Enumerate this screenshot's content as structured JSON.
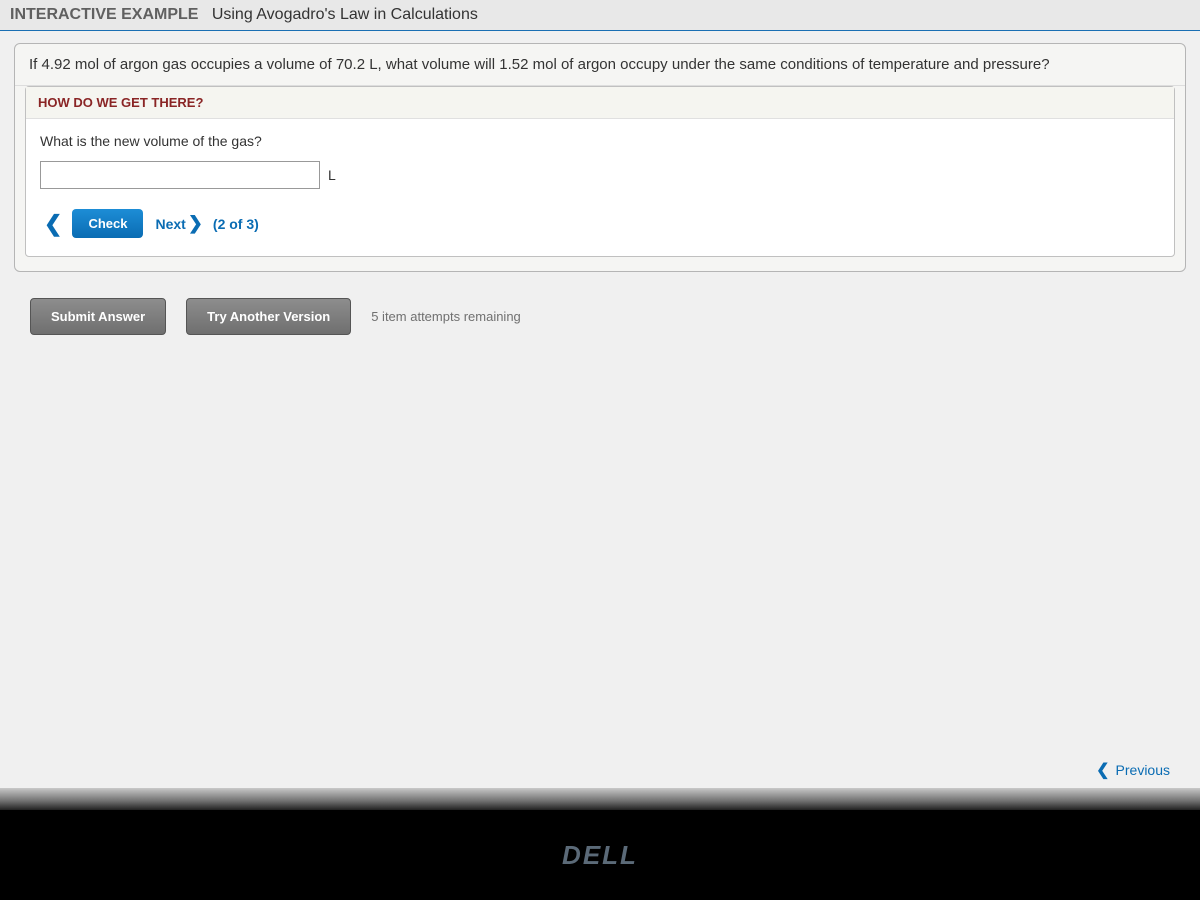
{
  "header": {
    "label": "INTERACTIVE EXAMPLE",
    "title": "Using Avogadro's Law in Calculations"
  },
  "question": "If 4.92 mol of argon gas occupies a volume of 70.2 L, what volume will 1.52 mol of argon occupy under the same conditions of temperature and pressure?",
  "panel": {
    "subheader": "HOW DO WE GET THERE?",
    "prompt": "What is the new volume of the gas?",
    "input_value": "",
    "unit": "L",
    "check_label": "Check",
    "next_label": "Next",
    "step_counter": "(2 of 3)"
  },
  "footer": {
    "submit_label": "Submit Answer",
    "try_label": "Try Another Version",
    "attempts": "5 item attempts remaining"
  },
  "bottom_nav": {
    "previous_label": "Previous"
  },
  "monitor_brand": "DELL"
}
